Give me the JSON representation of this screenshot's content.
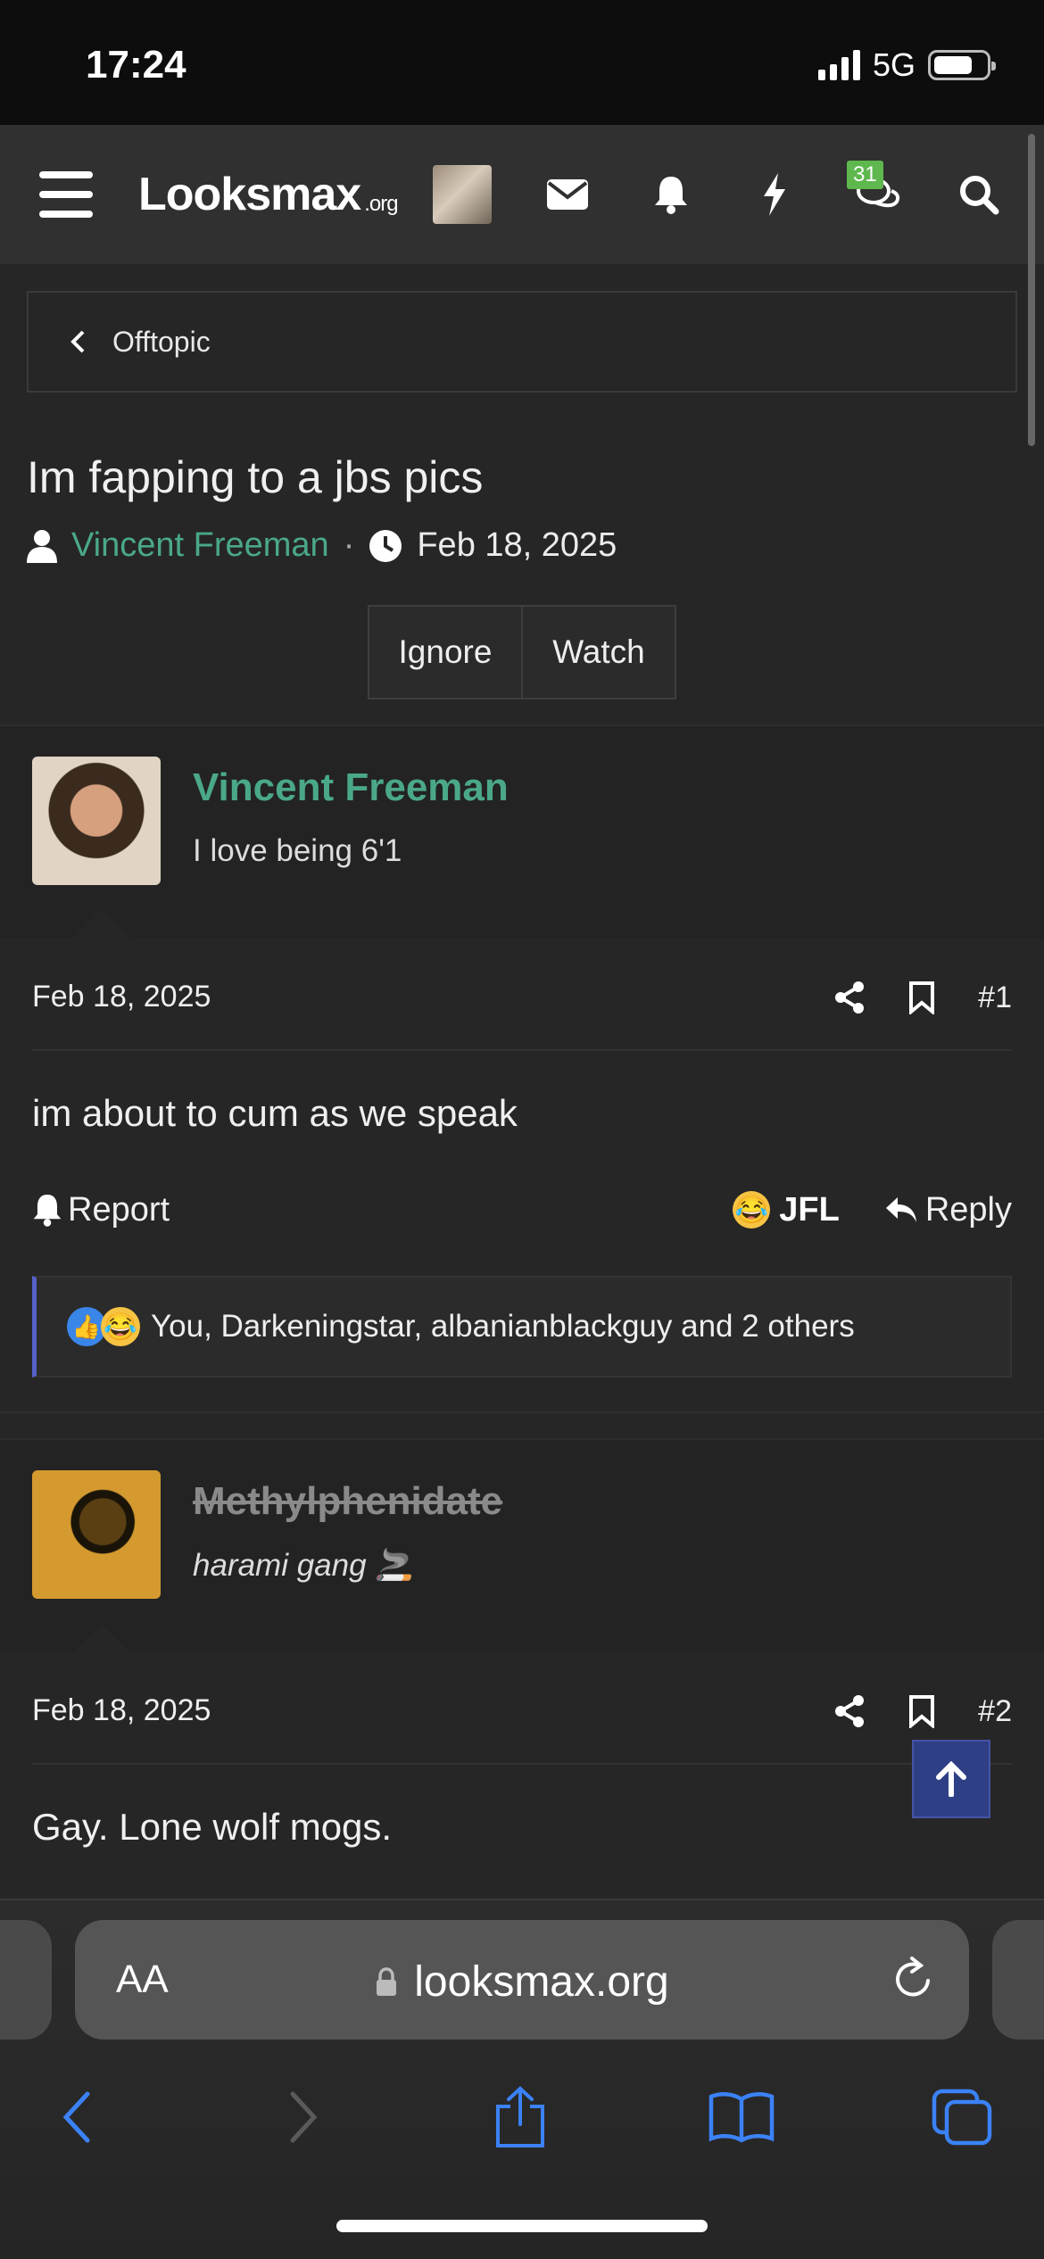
{
  "status_bar": {
    "time": "17:24",
    "network": "5G"
  },
  "nav": {
    "logo_main": "Looksmax",
    "logo_tld": ".org",
    "conversations_badge": "31"
  },
  "breadcrumb": {
    "label": "Offtopic"
  },
  "thread": {
    "title": "Im fapping to a jbs pics",
    "author": "Vincent Freeman",
    "separator": "·",
    "date": "Feb 18, 2025",
    "ignore_label": "Ignore",
    "watch_label": "Watch"
  },
  "posts": [
    {
      "username": "Vincent Freeman",
      "user_title": "I love being 6'1",
      "date": "Feb 18, 2025",
      "number": "#1",
      "body": "im about to cum as we speak",
      "report_label": "Report",
      "reaction_label": "JFL",
      "reply_label": "Reply",
      "reactions_summary": "You, Darkeningstar, albanianblackguy and 2 others"
    },
    {
      "username": "Methylphenidate",
      "user_title": "harami gang 🚬",
      "date": "Feb 18, 2025",
      "number": "#2",
      "body": "Gay. Lone wolf mogs."
    }
  ],
  "browser": {
    "aa_label": "AA",
    "url": "looksmax.org"
  },
  "colors": {
    "accent_username": "#4aa889",
    "scroll_top_button": "#2f3f85",
    "safari_icon_blue": "#3b82f6"
  }
}
